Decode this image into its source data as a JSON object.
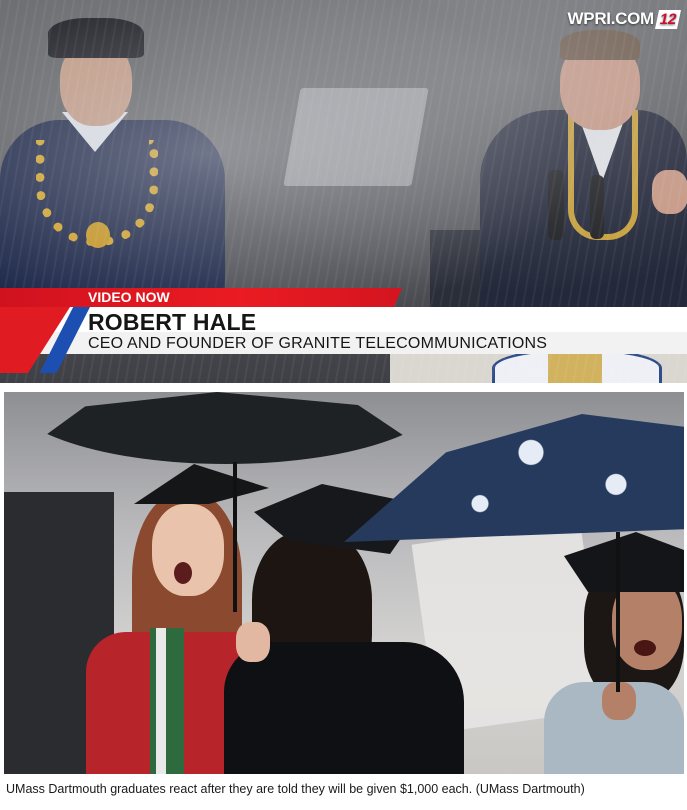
{
  "video": {
    "logo_text": "WPRI.COM",
    "logo_badge": "12",
    "lower_third": {
      "tag": "VIDEO NOW",
      "name": "ROBERT HALE",
      "title": "CEO AND FOUNDER OF GRANITE TELECOMMUNICATIONS"
    },
    "colors": {
      "tag_red": "#e11b22",
      "accent_blue": "#1d4fb3"
    }
  },
  "photo": {
    "caption": "UMass Dartmouth graduates react after they are told they will be given $1,000 each. (UMass Dartmouth)"
  }
}
